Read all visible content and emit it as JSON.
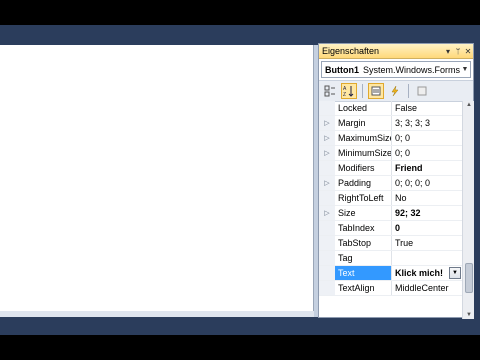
{
  "properties_panel": {
    "title": "Eigenschaften",
    "title_controls": [
      "▾",
      "ᛘ",
      "✕"
    ],
    "object_selector": {
      "name": "Button1",
      "type": "System.Windows.Forms.I"
    },
    "toolbar": {
      "categorized_icon": "categorized-icon",
      "alphabetical_icon": "alphabetical-icon",
      "properties_icon": "properties-icon",
      "events_icon": "events-icon",
      "pages_icon": "property-pages-icon"
    },
    "rows": [
      {
        "name": "Locked",
        "value": "False",
        "expandable": false,
        "bold": false
      },
      {
        "name": "Margin",
        "value": "3; 3; 3; 3",
        "expandable": true,
        "bold": false
      },
      {
        "name": "MaximumSize",
        "value": "0; 0",
        "expandable": true,
        "bold": false
      },
      {
        "name": "MinimumSize",
        "value": "0; 0",
        "expandable": true,
        "bold": false
      },
      {
        "name": "Modifiers",
        "value": "Friend",
        "expandable": false,
        "bold": true
      },
      {
        "name": "Padding",
        "value": "0; 0; 0; 0",
        "expandable": true,
        "bold": false
      },
      {
        "name": "RightToLeft",
        "value": "No",
        "expandable": false,
        "bold": false
      },
      {
        "name": "Size",
        "value": "92; 32",
        "expandable": true,
        "bold": true
      },
      {
        "name": "TabIndex",
        "value": "0",
        "expandable": false,
        "bold": true
      },
      {
        "name": "TabStop",
        "value": "True",
        "expandable": false,
        "bold": false
      },
      {
        "name": "Tag",
        "value": "",
        "expandable": false,
        "bold": false
      },
      {
        "name": "Text",
        "value": "Klick mich!",
        "expandable": false,
        "bold": true,
        "selected": true
      },
      {
        "name": "TextAlign",
        "value": "MiddleCenter",
        "expandable": false,
        "bold": false
      }
    ]
  },
  "colors": {
    "selection": "#3399ff",
    "ide_background": "#2b3d5c",
    "title_gradient_top": "#fff3c6",
    "title_gradient_bottom": "#ffd87a"
  }
}
